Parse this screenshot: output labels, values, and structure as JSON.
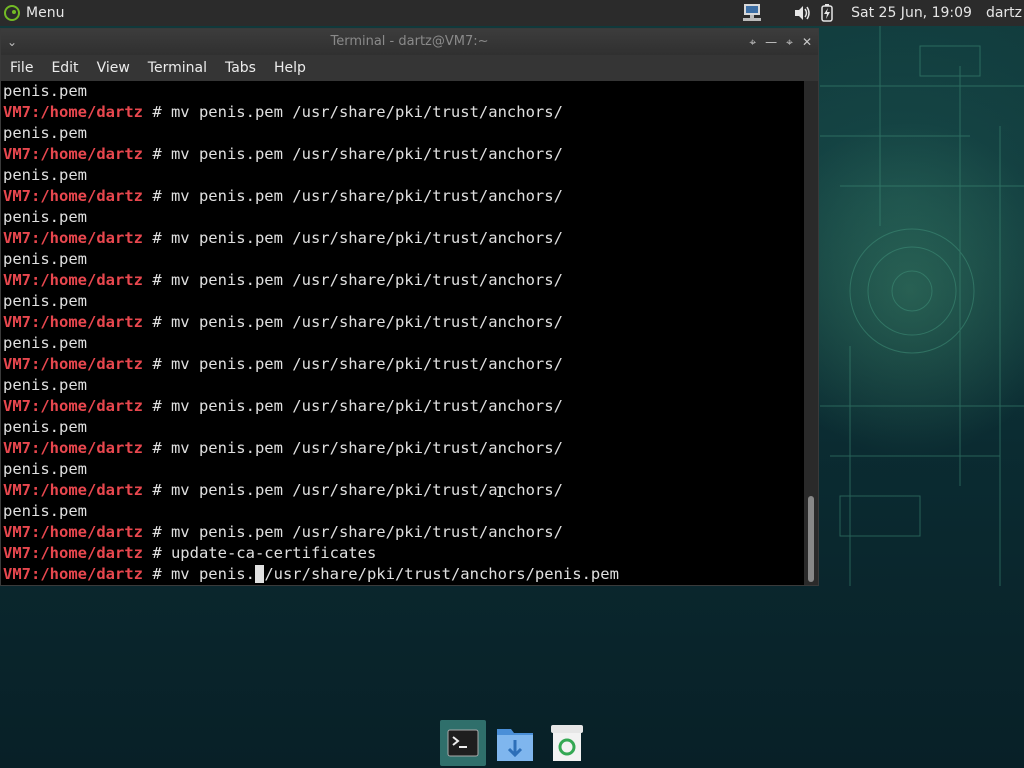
{
  "panel": {
    "menu_label": "Menu",
    "clock": "Sat 25 Jun, 19:09",
    "user": "dartz"
  },
  "window": {
    "title": "Terminal - dartz@VM7:~",
    "menu": [
      "File",
      "Edit",
      "View",
      "Terminal",
      "Tabs",
      "Help"
    ]
  },
  "terminal": {
    "lines": [
      {
        "out": "penis.pem"
      },
      {
        "prompt": "VM7:/home/dartz",
        "cmd": " # mv penis.pem /usr/share/pki/trust/anchors/"
      },
      {
        "out": "penis.pem"
      },
      {
        "prompt": "VM7:/home/dartz",
        "cmd": " # mv penis.pem /usr/share/pki/trust/anchors/"
      },
      {
        "out": "penis.pem"
      },
      {
        "prompt": "VM7:/home/dartz",
        "cmd": " # mv penis.pem /usr/share/pki/trust/anchors/"
      },
      {
        "out": "penis.pem"
      },
      {
        "prompt": "VM7:/home/dartz",
        "cmd": " # mv penis.pem /usr/share/pki/trust/anchors/"
      },
      {
        "out": "penis.pem"
      },
      {
        "prompt": "VM7:/home/dartz",
        "cmd": " # mv penis.pem /usr/share/pki/trust/anchors/"
      },
      {
        "out": "penis.pem"
      },
      {
        "prompt": "VM7:/home/dartz",
        "cmd": " # mv penis.pem /usr/share/pki/trust/anchors/"
      },
      {
        "out": "penis.pem"
      },
      {
        "prompt": "VM7:/home/dartz",
        "cmd": " # mv penis.pem /usr/share/pki/trust/anchors/"
      },
      {
        "out": "penis.pem"
      },
      {
        "prompt": "VM7:/home/dartz",
        "cmd": " # mv penis.pem /usr/share/pki/trust/anchors/"
      },
      {
        "out": "penis.pem"
      },
      {
        "prompt": "VM7:/home/dartz",
        "cmd": " # mv penis.pem /usr/share/pki/trust/anchors/"
      },
      {
        "out": "penis.pem"
      },
      {
        "prompt": "VM7:/home/dartz",
        "cmd": " # mv penis.pem /usr/share/pki/trust/anchors/"
      },
      {
        "out": "penis.pem"
      },
      {
        "prompt": "VM7:/home/dartz",
        "cmd": " # mv penis.pem /usr/share/pki/trust/anchors/"
      },
      {
        "prompt": "VM7:/home/dartz",
        "cmd": " # update-ca-certificates"
      }
    ],
    "current": {
      "prompt": "VM7:/home/dartz",
      "before_cursor": " # mv penis.",
      "cursor_char": " ",
      "after_cursor": "/usr/share/pki/trust/anchors/penis.pem"
    }
  },
  "dock": {
    "items": [
      "terminal-icon",
      "file-manager-icon",
      "trash-icon"
    ]
  },
  "colors": {
    "prompt": "#e8474e",
    "terminal_bg": "#000000",
    "panel_bg": "#2b2b2b"
  }
}
